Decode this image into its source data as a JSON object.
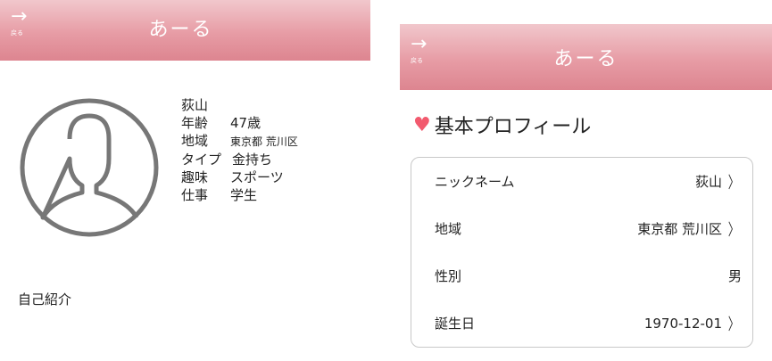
{
  "left": {
    "header": {
      "back_arrow": "→",
      "back_label": "戻る",
      "title": "あーる"
    },
    "profile": {
      "name": "荻山",
      "rows": [
        {
          "key": "年齢",
          "value": "47歳"
        },
        {
          "key": "地域",
          "value": "東京都 荒川区"
        },
        {
          "key": "タイプ",
          "value": "金持ち"
        },
        {
          "key": "趣味",
          "value": "スポーツ"
        },
        {
          "key": "仕事",
          "value": "学生"
        }
      ]
    },
    "intro_label": "自己紹介",
    "avatar_icon": "user-avatar-icon"
  },
  "right": {
    "header": {
      "back_arrow": "→",
      "back_label": "戻る",
      "title": "あーる"
    },
    "section": {
      "heart": "♥",
      "title": "基本プロフィール"
    },
    "items": [
      {
        "label": "ニックネーム",
        "value": "荻山",
        "chevron": "〉"
      },
      {
        "label": "地域",
        "value": "東京都 荒川区",
        "chevron": "〉"
      },
      {
        "label": "性別",
        "value": "男",
        "chevron": ""
      },
      {
        "label": "誕生日",
        "value": "1970-12-01",
        "chevron": "〉"
      }
    ]
  },
  "colors": {
    "header_gradient_top": "#f1c7cc",
    "header_gradient_bottom": "#dd8590",
    "heart": "#f25a6e"
  }
}
